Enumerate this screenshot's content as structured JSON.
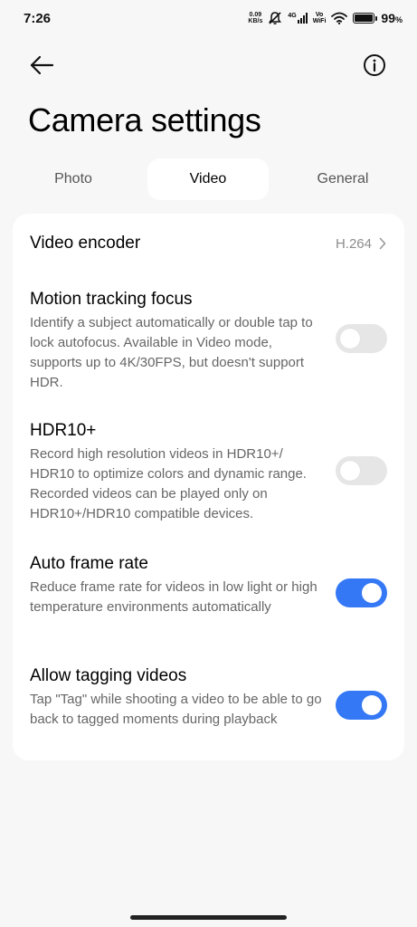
{
  "status_bar": {
    "time": "7:26",
    "net_speed_value": "0.09",
    "net_speed_unit": "KB/s",
    "network_type": "4G",
    "vowifi_top": "Vo",
    "vowifi_bottom": "WiFi",
    "battery_percent": "99",
    "battery_percent_sign": "%",
    "battery_level": 0.99
  },
  "header": {
    "title": "Camera settings"
  },
  "tabs": [
    {
      "label": "Photo",
      "active": false
    },
    {
      "label": "Video",
      "active": true
    },
    {
      "label": "General",
      "active": false
    }
  ],
  "settings": {
    "video_encoder": {
      "title": "Video encoder",
      "value": "H.264"
    },
    "motion_tracking": {
      "title": "Motion tracking focus",
      "description": "Identify a subject automatically or double tap to lock autofocus. Available in Video mode, supports up to 4K/30FPS, but doesn't support HDR.",
      "enabled": false
    },
    "hdr10": {
      "title": "HDR10+",
      "description": "Record high resolution videos in HDR10+/ HDR10 to optimize colors and dynamic range. Recorded videos can be played only on HDR10+/HDR10 compatible devices.",
      "enabled": false
    },
    "auto_frame_rate": {
      "title": "Auto frame rate",
      "description": "Reduce frame rate for videos in low light or high temperature environments automatically",
      "enabled": true
    },
    "allow_tagging": {
      "title": "Allow tagging videos",
      "description": "Tap \"Tag\" while shooting a video to be able to go back to tagged moments during playback",
      "enabled": true
    }
  },
  "colors": {
    "accent": "#3478f6",
    "toggle_off": "#e6e6e6",
    "background": "#f7f7f7",
    "card": "#ffffff"
  },
  "icons": {
    "back": "arrow-left-icon",
    "info": "info-circle-icon",
    "chevron": "chevron-right-icon"
  }
}
